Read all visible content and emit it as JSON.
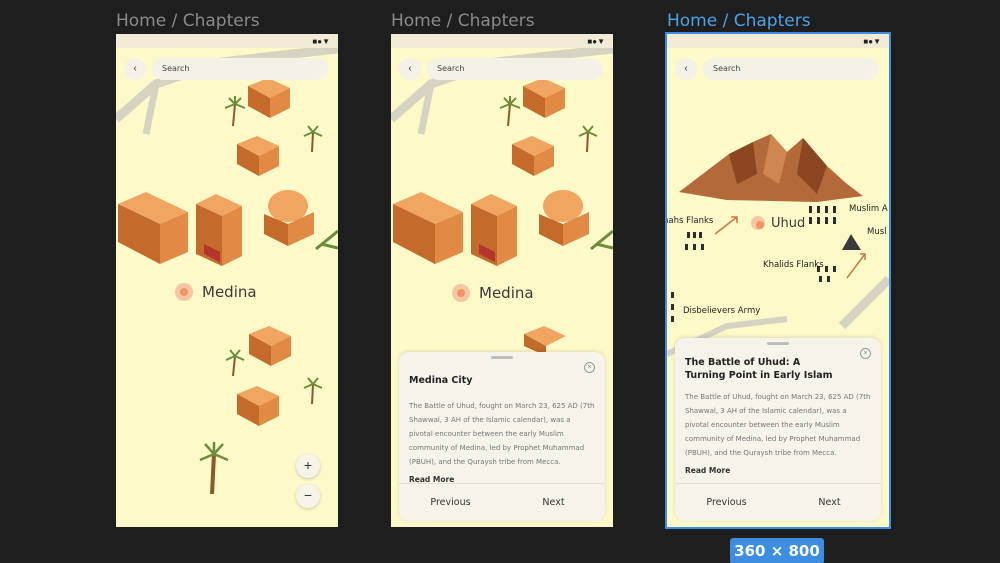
{
  "breadcrumb": "Home / Chapters",
  "status_icons": "■●▼",
  "search_placeholder": "Search",
  "back_glyph": "‹",
  "city_medina": "Medina",
  "city_uhud": "Uhud",
  "zoom_in": "+",
  "zoom_out": "−",
  "close_glyph": "×",
  "sheet_medina": {
    "title": "Medina City",
    "body": "The Battle of Uhud, fought on March 23, 625 AD (7th Shawwal, 3 AH of the Islamic calendar), was a pivotal encounter between the early Muslim community of Medina, led by Prophet Muhammad (PBUH), and the Quraysh tribe from Mecca.",
    "read_more": "Read More",
    "previous": "Previous",
    "next": "Next"
  },
  "sheet_uhud": {
    "title_line1": "The Battle of Uhud: A",
    "title_line2": "Turning Point in Early Islam",
    "body": "The Battle of Uhud, fought on March 23, 625 AD (7th Shawwal, 3 AH of the Islamic calendar), was a pivotal encounter between the early Muslim community of Medina, led by Prophet Muhammad (PBUH), and the Quraysh tribe from Mecca.",
    "read_more": "Read More",
    "previous": "Previous",
    "next": "Next"
  },
  "map_labels": {
    "kahs_flanks": "hahs Flanks",
    "muslim_a": "Muslim A",
    "musl": "Musl",
    "khalids_flanks": "Khalids Flanks",
    "disbelievers_army": "Disbelievers Army"
  },
  "frame_size": "360 × 800",
  "colors": {
    "background": "#1e1e1e",
    "map": "#fdf9c9",
    "selection": "#3d8ee0",
    "building": "#d9823d",
    "city_dot": "#f29466"
  }
}
